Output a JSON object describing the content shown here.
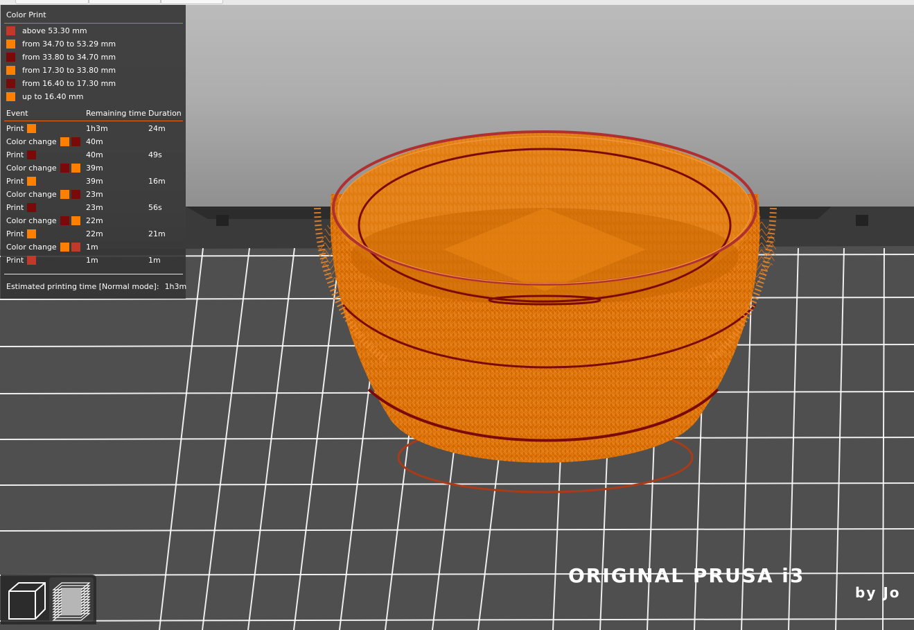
{
  "legend": {
    "title": "Color Print",
    "ranges": [
      {
        "label": "above 53.30 mm",
        "color": "#c0392b"
      },
      {
        "label": "from 34.70 to 53.29 mm",
        "color": "#ff8000"
      },
      {
        "label": "from 33.80 to 34.70 mm",
        "color": "#7a0a0a"
      },
      {
        "label": "from 17.30 to 33.80 mm",
        "color": "#ff8000"
      },
      {
        "label": "from 16.40 to 17.30 mm",
        "color": "#7a0a0a"
      },
      {
        "label": "up to 16.40 mm",
        "color": "#ff8000"
      }
    ],
    "table_headers": {
      "event": "Event",
      "remaining": "Remaining time",
      "duration": "Duration"
    },
    "events": [
      {
        "event": "Print",
        "colors": [
          "#ff8000"
        ],
        "remaining": "1h3m",
        "duration": "24m"
      },
      {
        "event": "Color change",
        "colors": [
          "#ff8000",
          "#7a0a0a"
        ],
        "remaining": "40m",
        "duration": ""
      },
      {
        "event": "Print",
        "colors": [
          "#7a0a0a"
        ],
        "remaining": "40m",
        "duration": "49s"
      },
      {
        "event": "Color change",
        "colors": [
          "#7a0a0a",
          "#ff8000"
        ],
        "remaining": "39m",
        "duration": ""
      },
      {
        "event": "Print",
        "colors": [
          "#ff8000"
        ],
        "remaining": "39m",
        "duration": "16m"
      },
      {
        "event": "Color change",
        "colors": [
          "#ff8000",
          "#7a0a0a"
        ],
        "remaining": "23m",
        "duration": ""
      },
      {
        "event": "Print",
        "colors": [
          "#7a0a0a"
        ],
        "remaining": "23m",
        "duration": "56s"
      },
      {
        "event": "Color change",
        "colors": [
          "#7a0a0a",
          "#ff8000"
        ],
        "remaining": "22m",
        "duration": ""
      },
      {
        "event": "Print",
        "colors": [
          "#ff8000"
        ],
        "remaining": "22m",
        "duration": "21m"
      },
      {
        "event": "Color change",
        "colors": [
          "#ff8000",
          "#c0392b"
        ],
        "remaining": "1m",
        "duration": ""
      },
      {
        "event": "Print",
        "colors": [
          "#c0392b"
        ],
        "remaining": "1m",
        "duration": "1m"
      }
    ],
    "estimated_label": "Estimated printing time [Normal mode]:",
    "estimated_value": "1h3m"
  },
  "bed": {
    "logo": "ORIGINAL PRUSA i3",
    "byline": "by Jo",
    "grid_color": "#ffffff"
  },
  "colors": {
    "accent": "#ed6b21",
    "model": "#d86a00",
    "band": "#7a0a0a"
  },
  "view_buttons": [
    {
      "name": "iso-view-icon",
      "selected": false
    },
    {
      "name": "layers-view-icon",
      "selected": true
    }
  ]
}
